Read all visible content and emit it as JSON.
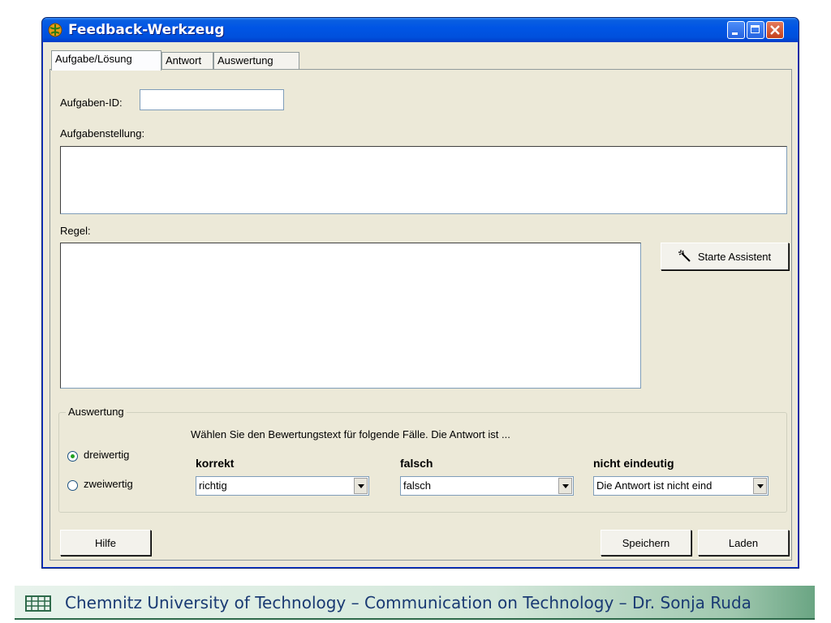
{
  "window": {
    "title": "Feedback-Werkzeug"
  },
  "tabs": [
    {
      "label": "Aufgabe/Lösung"
    },
    {
      "label": "Antwort"
    },
    {
      "label": "Auswertung"
    }
  ],
  "form": {
    "aufgaben_id_label": "Aufgaben-ID:",
    "aufgaben_id_value": "",
    "aufgabenstellung_label": "Aufgabenstellung:",
    "regel_label": "Regel:",
    "assistant_button": "Starte Assistent"
  },
  "auswertung": {
    "group_title": "Auswertung",
    "hint": "Wählen Sie den Bewertungstext für folgende Fälle. Die Antwort ist ...",
    "radio_dreiwertig": "dreiwertig",
    "radio_zweiwertig": "zweiwertig",
    "selected_mode": "dreiwertig",
    "col_korrekt": "korrekt",
    "col_falsch": "falsch",
    "col_nicht_eindeutig": "nicht eindeutig",
    "select_korrekt": "richtig",
    "select_falsch": "falsch",
    "select_nicht_eindeutig": "Die Antwort ist nicht eind"
  },
  "buttons": {
    "help": "Hilfe",
    "save": "Speichern",
    "load": "Laden"
  },
  "footer": {
    "text": "Chemnitz University of Technology – Communication on Technology – Dr. Sonja Ruda"
  },
  "colors": {
    "titlebar": "#0055e5",
    "window_bg": "#ece9d8",
    "footer_text": "#1a3a73"
  }
}
